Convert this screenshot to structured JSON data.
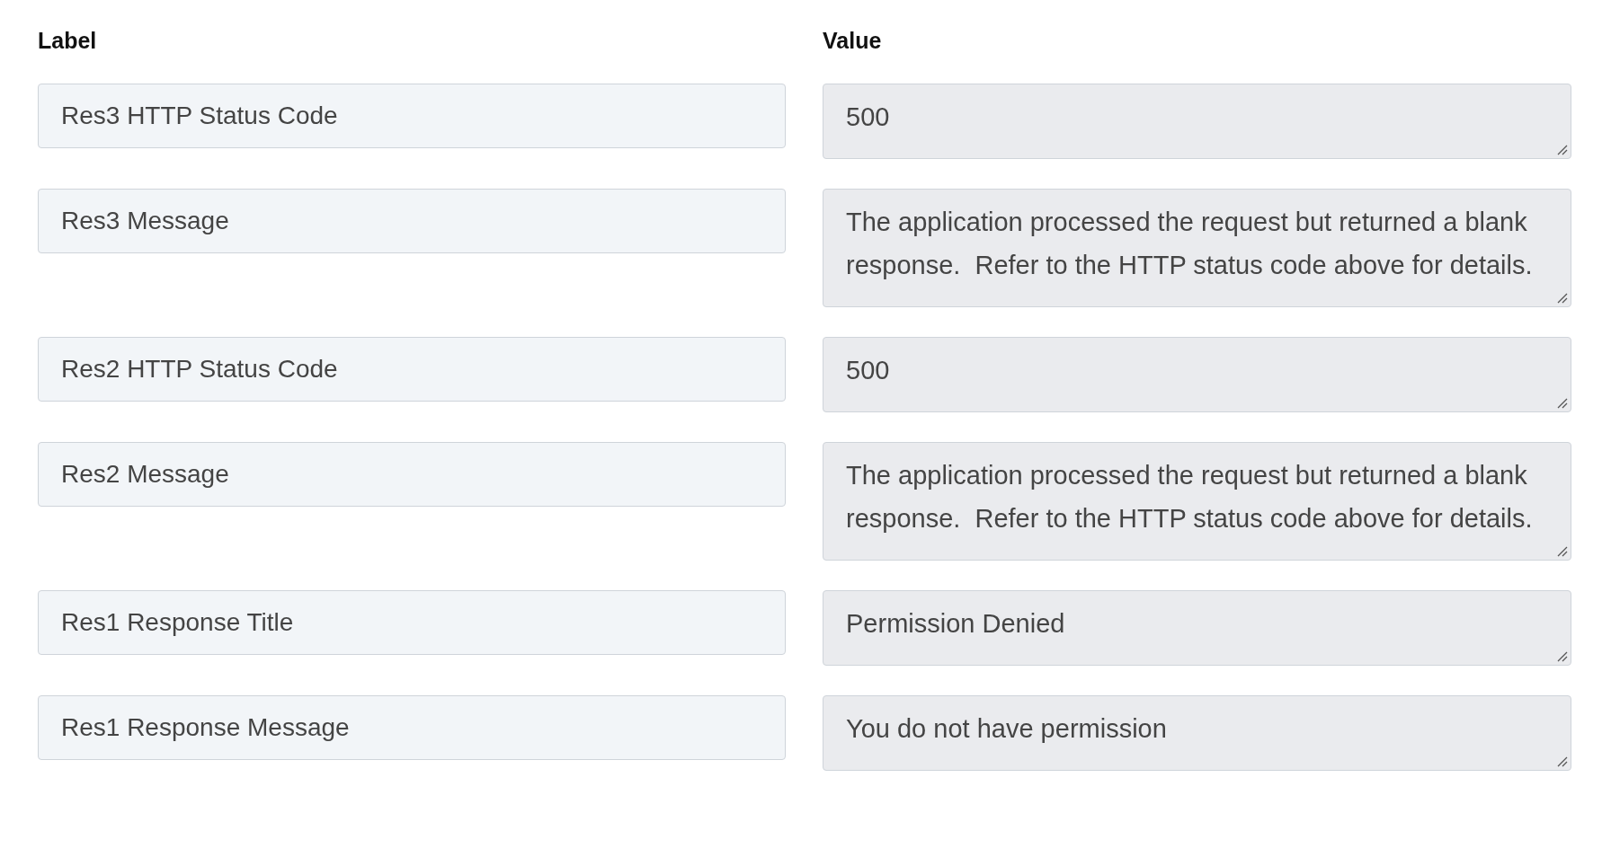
{
  "headers": {
    "label": "Label",
    "value": "Value"
  },
  "rows": [
    {
      "label": "Res3 HTTP Status Code",
      "value": "500"
    },
    {
      "label": "Res3 Message",
      "value": "The application processed the request but returned a blank response.  Refer to the HTTP status code above for details."
    },
    {
      "label": "Res2 HTTP Status Code",
      "value": "500"
    },
    {
      "label": "Res2 Message",
      "value": "The application processed the request but returned a blank response.  Refer to the HTTP status code above for details."
    },
    {
      "label": "Res1 Response Title",
      "value": "Permission Denied"
    },
    {
      "label": "Res1 Response Message",
      "value": "You do not have permission"
    }
  ]
}
